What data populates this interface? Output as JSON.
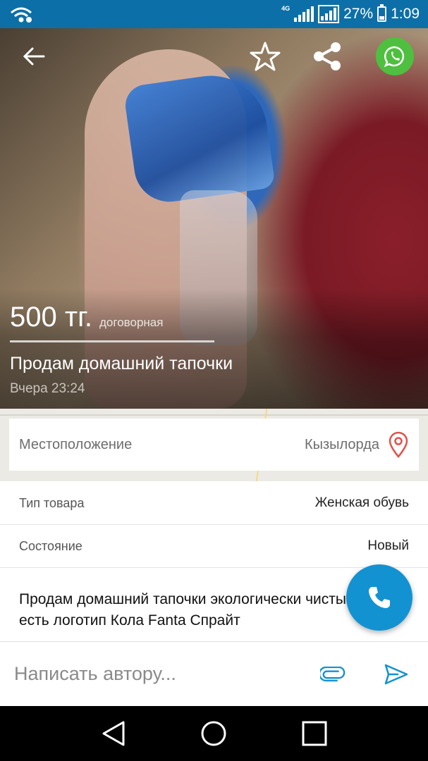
{
  "status_bar": {
    "network": "4G",
    "battery_text": "27%",
    "battery_level": 0.27,
    "time": "1:09"
  },
  "listing": {
    "price": "500 тг.",
    "price_note": "договорная",
    "title": "Продам домашний тапочки",
    "date": "Вчера 23:24"
  },
  "location": {
    "label": "Местоположение",
    "value": "Кызылорда"
  },
  "details": [
    {
      "label": "Тип товара",
      "value": "Женская обувь"
    },
    {
      "label": "Состояние",
      "value": "Новый"
    }
  ],
  "description": "Продам домашний тапочки экологически чистый товар есть логотип Кола Fanta Спрайт",
  "message": {
    "placeholder": "Написать автору..."
  },
  "colors": {
    "status_bar": "#0d6fa8",
    "accent": "#1392d1",
    "whatsapp": "#4fbf3f",
    "location_pin": "#e0524a"
  },
  "icons": [
    "wifi-icon",
    "signal-icon",
    "battery-icon",
    "back-arrow-icon",
    "star-icon",
    "share-icon",
    "whatsapp-icon",
    "location-pin-icon",
    "phone-icon",
    "paperclip-icon",
    "send-icon",
    "nav-back-icon",
    "nav-home-icon",
    "nav-recents-icon"
  ]
}
